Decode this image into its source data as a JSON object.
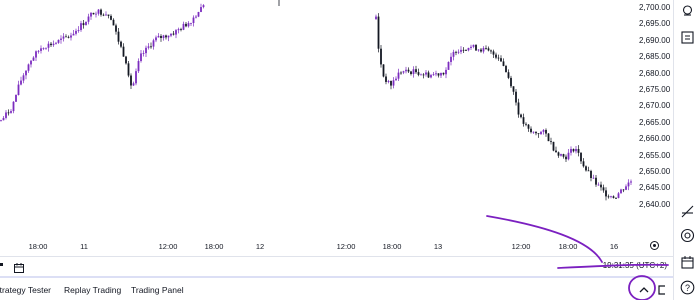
{
  "price_axis": {
    "labels": [
      "2,700.00",
      "2,695.00",
      "2,690.00",
      "2,685.00",
      "2,680.00",
      "2,675.00",
      "2,670.00",
      "2,665.00",
      "2,660.00",
      "2,655.00",
      "2,650.00",
      "2,645.00",
      "2,640.00"
    ]
  },
  "time_axis": {
    "labels": [
      "18:00",
      "11",
      "12:00",
      "18:00",
      "12",
      "12:00",
      "18:00",
      "13",
      "12:00",
      "18:00",
      "16"
    ]
  },
  "status": {
    "clock": "19:31:35 (UTC+2)"
  },
  "bottom_tabs": [
    "Strategy Tester",
    "Replay Trading",
    "Trading Panel"
  ],
  "chart_data": {
    "type": "candlestick",
    "x": [
      "18:00",
      "11",
      "12:00",
      "18:00",
      "12",
      "12:00",
      "18:00",
      "13",
      "12:00",
      "18:00",
      "16"
    ],
    "ylim": [
      2636,
      2703
    ],
    "price_path": [
      [
        0,
        2669
      ],
      [
        12,
        2673
      ],
      [
        20,
        2680
      ],
      [
        30,
        2686
      ],
      [
        42,
        2690
      ],
      [
        55,
        2691
      ],
      [
        70,
        2693
      ],
      [
        85,
        2697
      ],
      [
        95,
        2700
      ],
      [
        110,
        2699
      ],
      [
        118,
        2692
      ],
      [
        126,
        2686
      ],
      [
        132,
        2678
      ],
      [
        140,
        2687
      ],
      [
        155,
        2692
      ],
      [
        175,
        2694
      ],
      [
        190,
        2697
      ],
      [
        205,
        2702
      ],
      [
        375,
        2702
      ],
      [
        378,
        2690
      ],
      [
        383,
        2682
      ],
      [
        390,
        2679
      ],
      [
        400,
        2683
      ],
      [
        415,
        2683
      ],
      [
        430,
        2682
      ],
      [
        445,
        2683
      ],
      [
        455,
        2689
      ],
      [
        470,
        2690
      ],
      [
        485,
        2689
      ],
      [
        500,
        2687
      ],
      [
        512,
        2679
      ],
      [
        520,
        2670
      ],
      [
        530,
        2666
      ],
      [
        545,
        2666
      ],
      [
        555,
        2661
      ],
      [
        565,
        2659
      ],
      [
        575,
        2662
      ],
      [
        585,
        2656
      ],
      [
        595,
        2652
      ],
      [
        605,
        2649
      ],
      [
        615,
        2648
      ],
      [
        625,
        2651
      ],
      [
        633,
        2653
      ]
    ],
    "colors": {
      "up": "#7b2cbf",
      "down": "#131722"
    }
  },
  "icons": {
    "chart_settings": "gear-icon",
    "calendar": "calendar-icon",
    "collapse": "chevron-up-icon",
    "maximize": "expand-icon",
    "help": "question-icon"
  },
  "annotation_color": "#7b20c0"
}
